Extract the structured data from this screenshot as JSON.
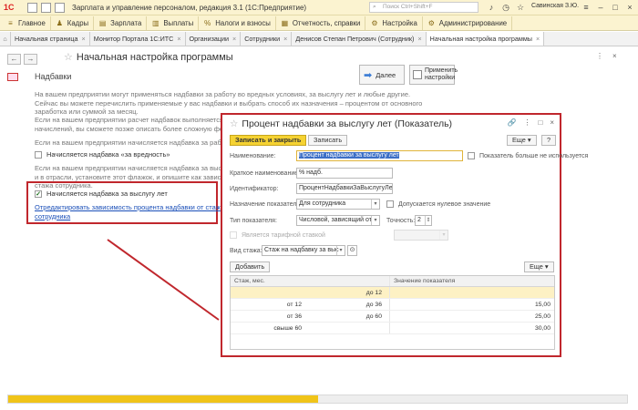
{
  "titlebar": {
    "logo": "1С",
    "app_title": "Зарплата и управление персоналом, редакция 3.1  (1С:Предприятие)",
    "search_placeholder": "Поиск Ctrl+Shift+F",
    "user": "Савинская З.Ю."
  },
  "menu": {
    "items": [
      {
        "label": "Главное",
        "icon": "≡"
      },
      {
        "label": "Кадры",
        "icon": "♟"
      },
      {
        "label": "Зарплата",
        "icon": "▤"
      },
      {
        "label": "Выплаты",
        "icon": "▥"
      },
      {
        "label": "Налоги и взносы",
        "icon": "%"
      },
      {
        "label": "Отчетность, справки",
        "icon": "▦"
      },
      {
        "label": "Настройка",
        "icon": "⚙"
      },
      {
        "label": "Администрирование",
        "icon": "⚙"
      }
    ]
  },
  "tabs": [
    {
      "label": "Начальная страница"
    },
    {
      "label": "Монитор Портала 1С:ИТС"
    },
    {
      "label": "Организации"
    },
    {
      "label": "Сотрудники"
    },
    {
      "label": "Денисов Степан Петрович (Сотрудник)"
    },
    {
      "label": "Начальная настройка программы",
      "active": true
    }
  ],
  "page": {
    "title": "Начальная настройка программы",
    "section_title": "Надбавки",
    "btn_next": "Далее",
    "btn_apply_line1": "Применить",
    "btn_apply_line2": "настройки",
    "para1": [
      "На вашем предприятии могут применяться надбавки за работу во вредных условиях, за выслугу лет и любые другие.",
      "Сейчас вы можете перечислить применяемые у вас надбавки и выбрать способ их назначения – процентом от основного",
      "заработка или суммой за месяц."
    ],
    "para2": [
      "Если на вашем предприятии расчет надбавок выполняется не от о",
      "начислений, вы сможете позже описать более сложную формулу"
    ],
    "para3": "Если на вашем предприятии начисляется надбавка за работу во вредных",
    "cb_harm": "Начисляется надбавка «за вредность»",
    "para4": [
      "Если на вашем предприятии начисляется надбавка за выслугу лет",
      "и в отрасли, установите этот флажок, и опишите как зависит процен",
      "стажа сотрудника."
    ],
    "cb_seniority": "Начисляется надбавка за выслугу лет",
    "link_line1": "Отредактировать зависимость процента надбавки от стажа",
    "link_line2": "сотрудника"
  },
  "dialog": {
    "title": "Процент надбавки за выслугу лет (Показатель)",
    "btn_save_close": "Записать и закрыть",
    "btn_save": "Записать",
    "btn_more": "Еще",
    "btn_help": "?",
    "lbl_name": "Наименование:",
    "val_name": "Процент надбавки за выслугу лет",
    "cb_unused": "Показатель больше не используется",
    "lbl_short": "Краткое наименование:",
    "val_short": "% надб.",
    "lbl_id": "Идентификатор:",
    "val_id": "ПроцентНадбавкиЗаВыслугуЛет",
    "lbl_purpose": "Назначение показателя:",
    "val_purpose": "Для сотрудника",
    "cb_zero": "Допускается нулевое значение",
    "lbl_type": "Тип показателя:",
    "val_type": "Числовой, зависящий от",
    "lbl_precision": "Точность:",
    "val_precision": "2",
    "cb_tariff": "Является тарифной ставкой",
    "lbl_seniority": "Вид стажа:",
    "val_seniority": "Стаж на надбавку за выс",
    "btn_add": "Добавить",
    "btn_more2": "Еще",
    "table": {
      "col_seniority": "Стаж, мес.",
      "col_value": "Значение показателя",
      "rows": [
        {
          "from": "",
          "to": "до 12",
          "value": ""
        },
        {
          "from": "от 12",
          "to": "до 36",
          "value": "15,00"
        },
        {
          "from": "от 36",
          "to": "до 60",
          "value": "25,00"
        },
        {
          "from": "свыше 60",
          "to": "",
          "value": "30,00"
        }
      ]
    }
  },
  "progress": {
    "fraction": 0.5
  },
  "colors": {
    "accent": "#f5d232",
    "highlight_box": "#c0272d",
    "link": "#1a4fb8"
  }
}
